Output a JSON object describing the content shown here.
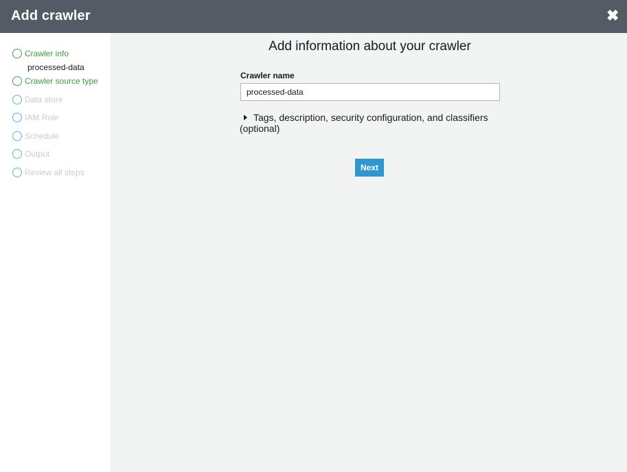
{
  "header": {
    "title": "Add crawler",
    "close_icon": "close-icon"
  },
  "sidebar": {
    "steps": [
      {
        "label": "Crawler info",
        "state": "active",
        "sub": "processed-data"
      },
      {
        "label": "Crawler source type",
        "state": "active"
      },
      {
        "label": "Data store",
        "state": "pending"
      },
      {
        "label": "IAM Role",
        "state": "pending"
      },
      {
        "label": "Schedule",
        "state": "pending"
      },
      {
        "label": "Output",
        "state": "pending"
      },
      {
        "label": "Review all steps",
        "state": "pending"
      }
    ]
  },
  "main": {
    "title": "Add information about your crawler",
    "crawler_name_label": "Crawler name",
    "crawler_name_value": "processed-data",
    "optional_section_line1": "Tags, description, security configuration, and classifiers",
    "optional_section_line2": "(optional)",
    "next_label": "Next"
  },
  "colors": {
    "header_bg": "#545b64",
    "active_step": "#3c9b3e",
    "pending_step": "#c9ccce",
    "primary_button": "#2e97d2"
  }
}
